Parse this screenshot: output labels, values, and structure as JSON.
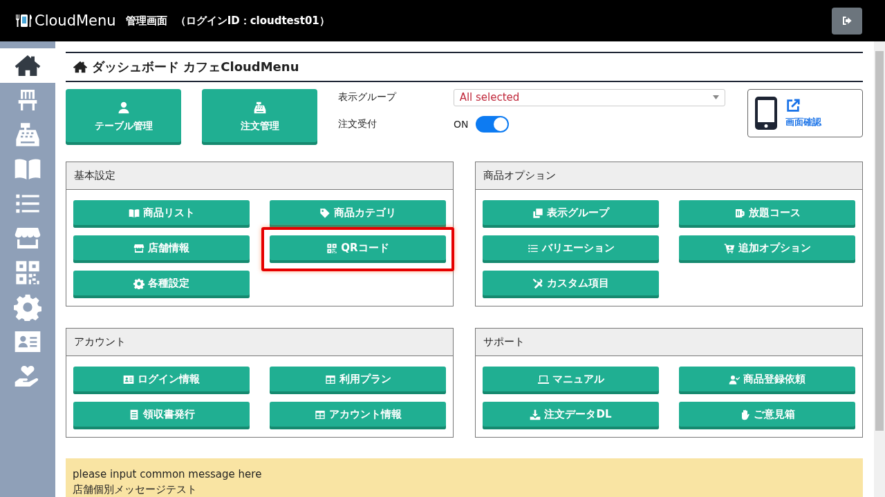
{
  "header": {
    "logo": "CloudMenu",
    "title": "管理画面",
    "login": "（ログインID：cloudtest01）"
  },
  "sidebar": {
    "items": [
      {
        "selected": true
      },
      {
        "selected": false
      },
      {
        "selected": false
      },
      {
        "selected": false
      },
      {
        "selected": false
      },
      {
        "selected": false
      },
      {
        "selected": false
      },
      {
        "selected": false
      },
      {
        "selected": false
      },
      {
        "selected": false
      }
    ]
  },
  "page_title": "ダッシュボード カフェCloudMenu",
  "quick_buttons": [
    {
      "label": "テーブル管理"
    },
    {
      "label": "注文管理"
    }
  ],
  "display_group": {
    "label": "表示グループ",
    "value": "All selected"
  },
  "order_acceptance": {
    "label": "注文受付",
    "state_text": "ON",
    "on": true
  },
  "preview": {
    "label": "画面確認"
  },
  "sections": [
    {
      "title": "基本設定",
      "buttons": [
        {
          "label": "商品リスト",
          "highlighted": false
        },
        {
          "label": "商品カテゴリ",
          "highlighted": false
        },
        {
          "label": "店舗情報",
          "highlighted": false
        },
        {
          "label": "QRコード",
          "highlighted": true
        },
        {
          "label": "各種設定",
          "highlighted": false
        }
      ]
    },
    {
      "title": "商品オプション",
      "buttons": [
        {
          "label": "表示グループ",
          "highlighted": false
        },
        {
          "label": "放題コース",
          "highlighted": false
        },
        {
          "label": "バリエーション",
          "highlighted": false
        },
        {
          "label": "追加オプション",
          "highlighted": false
        },
        {
          "label": "カスタム項目",
          "highlighted": false
        }
      ]
    },
    {
      "title": "アカウント",
      "buttons": [
        {
          "label": "ログイン情報",
          "highlighted": false
        },
        {
          "label": "利用プラン",
          "highlighted": false
        },
        {
          "label": "領収書発行",
          "highlighted": false
        },
        {
          "label": "アカウント情報",
          "highlighted": false
        }
      ]
    },
    {
      "title": "サポート",
      "buttons": [
        {
          "label": "マニュアル",
          "highlighted": false
        },
        {
          "label": "商品登録依頼",
          "highlighted": false
        },
        {
          "label": "注文データDL",
          "highlighted": false
        },
        {
          "label": "ご意見箱",
          "highlighted": false
        }
      ]
    }
  ],
  "message": {
    "lines": [
      "please input common message here",
      "店舗個別メッセージテスト"
    ]
  }
}
